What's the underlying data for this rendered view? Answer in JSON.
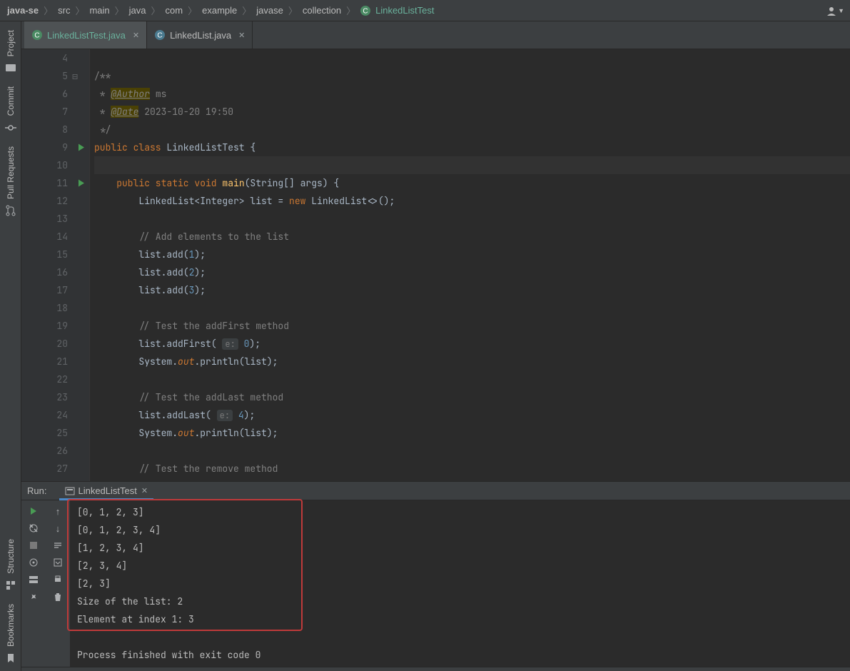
{
  "breadcrumbs": {
    "project": "java-se",
    "items": [
      "src",
      "main",
      "java",
      "com",
      "example",
      "javase",
      "collection"
    ],
    "class": "LinkedListTest"
  },
  "left_stripe": {
    "project": "Project",
    "commit": "Commit",
    "pull_requests": "Pull Requests",
    "structure": "Structure",
    "bookmarks": "Bookmarks"
  },
  "tabs": [
    {
      "name": "LinkedListTest.java",
      "active": true
    },
    {
      "name": "LinkedList.java",
      "active": false
    }
  ],
  "editor": {
    "line_start": 4,
    "lines": [
      {
        "n": 4,
        "html": ""
      },
      {
        "n": 5,
        "html": "<span class='c-comment'>/**</span>"
      },
      {
        "n": 6,
        "html": "<span class='c-comment'> * </span><span class='c-tag'>@Author</span><span class='c-comment'> ms</span>"
      },
      {
        "n": 7,
        "html": "<span class='c-comment'> * </span><span class='c-tag'>@Date</span><span class='c-comment'> 2023-10-20 19:50</span>"
      },
      {
        "n": 8,
        "html": "<span class='c-comment'> */</span>"
      },
      {
        "n": 9,
        "html": "<span class='c-kw'>public class </span><span class='c-type'>LinkedListTest </span><span class='c-text'>{</span>",
        "run": true
      },
      {
        "n": 10,
        "html": "",
        "hl": true
      },
      {
        "n": 11,
        "html": "    <span class='c-kw'>public static </span><span class='c-kw'>void </span><span class='c-method'>main</span><span class='c-text'>(String[] args) {</span>",
        "run": true
      },
      {
        "n": 12,
        "html": "        <span class='c-type'>LinkedList&lt;Integer&gt; list </span><span class='c-text'>= </span><span class='c-kw'>new </span><span class='c-type'>LinkedList&lt;&gt;</span><span class='c-text'>();</span>"
      },
      {
        "n": 13,
        "html": ""
      },
      {
        "n": 14,
        "html": "        <span class='c-comment'>// Add elements to the list</span>"
      },
      {
        "n": 15,
        "html": "        <span class='c-text'>list.add(</span><span class='c-num'>1</span><span class='c-text'>);</span>"
      },
      {
        "n": 16,
        "html": "        <span class='c-text'>list.add(</span><span class='c-num'>2</span><span class='c-text'>);</span>"
      },
      {
        "n": 17,
        "html": "        <span class='c-text'>list.add(</span><span class='c-num'>3</span><span class='c-text'>);</span>"
      },
      {
        "n": 18,
        "html": ""
      },
      {
        "n": 19,
        "html": "        <span class='c-comment'>// Test the addFirst method</span>"
      },
      {
        "n": 20,
        "html": "        <span class='c-text'>list.addFirst(</span> <span class='c-hint'>e:</span> <span class='c-num'>0</span><span class='c-text'>);</span>"
      },
      {
        "n": 21,
        "html": "        <span class='c-type'>System</span><span class='c-text'>.</span><span class='c-static'>out</span><span class='c-text'>.println(list);</span>"
      },
      {
        "n": 22,
        "html": ""
      },
      {
        "n": 23,
        "html": "        <span class='c-comment'>// Test the addLast method</span>"
      },
      {
        "n": 24,
        "html": "        <span class='c-text'>list.addLast(</span> <span class='c-hint'>e:</span> <span class='c-num'>4</span><span class='c-text'>);</span>"
      },
      {
        "n": 25,
        "html": "        <span class='c-type'>System</span><span class='c-text'>.</span><span class='c-static'>out</span><span class='c-text'>.println(list);</span>"
      },
      {
        "n": 26,
        "html": ""
      },
      {
        "n": 27,
        "html": "        <span class='c-comment'>// Test the remove method</span>"
      }
    ]
  },
  "run": {
    "label": "Run:",
    "config": "LinkedListTest",
    "output": [
      "[0, 1, 2, 3]",
      "[0, 1, 2, 3, 4]",
      "[1, 2, 3, 4]",
      "[2, 3, 4]",
      "[2, 3]",
      "Size of the list: 2",
      "Element at index 1: 3",
      "",
      "Process finished with exit code 0"
    ]
  }
}
